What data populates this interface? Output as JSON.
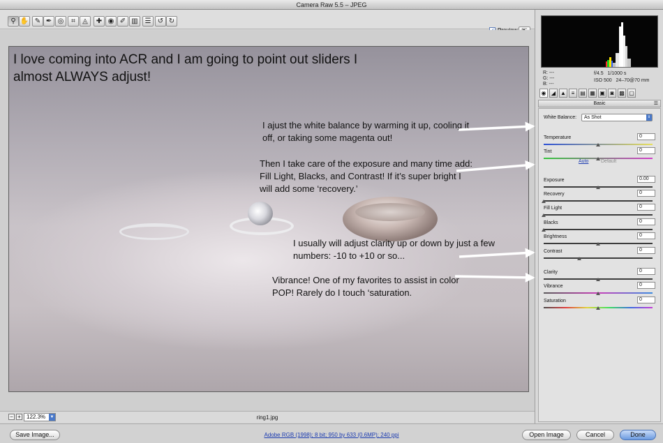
{
  "window": {
    "title": "Camera Raw 5.5  –  JPEG"
  },
  "toolbar": {
    "tools": [
      {
        "name": "zoom-tool",
        "icon": "magnifier-icon",
        "glyph": "⚲"
      },
      {
        "name": "hand-tool",
        "icon": "hand-icon",
        "glyph": "✋"
      },
      {
        "name": "white-balance-tool",
        "icon": "eyedropper-icon",
        "glyph": "✎"
      },
      {
        "name": "color-sampler-tool",
        "icon": "color-sampler-icon",
        "glyph": "✒"
      },
      {
        "name": "targeted-adjustment-tool",
        "icon": "target-icon",
        "glyph": "◎"
      },
      {
        "name": "crop-tool",
        "icon": "crop-icon",
        "glyph": "⌗"
      },
      {
        "name": "straighten-tool",
        "icon": "straighten-icon",
        "glyph": "◬"
      },
      {
        "name": "spot-removal-tool",
        "icon": "spot-icon",
        "glyph": "✚"
      },
      {
        "name": "red-eye-tool",
        "icon": "eye-icon",
        "glyph": "◉"
      },
      {
        "name": "adjustment-brush-tool",
        "icon": "brush-icon",
        "glyph": "✐"
      },
      {
        "name": "graduated-filter-tool",
        "icon": "gradient-icon",
        "glyph": "▥"
      },
      {
        "name": "preferences-button",
        "icon": "list-icon",
        "glyph": "☰"
      },
      {
        "name": "rotate-left-button",
        "icon": "rotate-left-icon",
        "glyph": "↺"
      },
      {
        "name": "rotate-right-button",
        "icon": "rotate-right-icon",
        "glyph": "↻"
      }
    ],
    "preview_label": "Preview",
    "preview_checked": true
  },
  "overlay": {
    "title": "I love coming into ACR and I am going to point out sliders I almost ALWAYS adjust!",
    "notes": [
      "I ajust the white balance by warming it up, cooling it off, or taking some magenta out!",
      "Then I take care of the exposure and many time add:  Fill Light, Blacks, and Contrast!  If it’s super bright I will add some ‘recovery.’",
      "I usually will adjust clarity up or down by just a few numbers:  -10 to +10 or so...",
      "Vibrance!  One of my favorites to assist in color POP!  Rarely do I touch ‘saturation."
    ]
  },
  "status": {
    "zoom": "122.3%",
    "filename": "ring1.jpg"
  },
  "readout": {
    "r": "R:  ---",
    "g": "G:  ---",
    "b": "B:  ---",
    "aperture": "f/4.5",
    "shutter": "1/1000 s",
    "iso": "ISO 500",
    "lens": "24–70@70 mm"
  },
  "panel": {
    "section_title": "Basic",
    "white_balance_label": "White Balance:",
    "white_balance_value": "As Shot",
    "auto_label": "Auto",
    "default_label": "Default",
    "sliders": [
      {
        "label": "Temperature",
        "value": "0",
        "pos": 0.5
      },
      {
        "label": "Tint",
        "value": "0",
        "pos": 0.5
      },
      {
        "label": "Exposure",
        "value": "0.00",
        "pos": 0.5
      },
      {
        "label": "Recovery",
        "value": "0",
        "pos": 0.0
      },
      {
        "label": "Fill Light",
        "value": "0",
        "pos": 0.0
      },
      {
        "label": "Blacks",
        "value": "0",
        "pos": 0.0
      },
      {
        "label": "Brightness",
        "value": "0",
        "pos": 0.5
      },
      {
        "label": "Contrast",
        "value": "0",
        "pos": 0.33
      },
      {
        "label": "Clarity",
        "value": "0",
        "pos": 0.5
      },
      {
        "label": "Vibrance",
        "value": "0",
        "pos": 0.5
      },
      {
        "label": "Saturation",
        "value": "0",
        "pos": 0.5
      }
    ]
  },
  "footer": {
    "save_label": "Save Image...",
    "info": "Adobe RGB (1998); 8 bit; 950 by 633 (0.6MP); 240 ppi",
    "open_label": "Open Image",
    "cancel_label": "Cancel",
    "done_label": "Done"
  }
}
